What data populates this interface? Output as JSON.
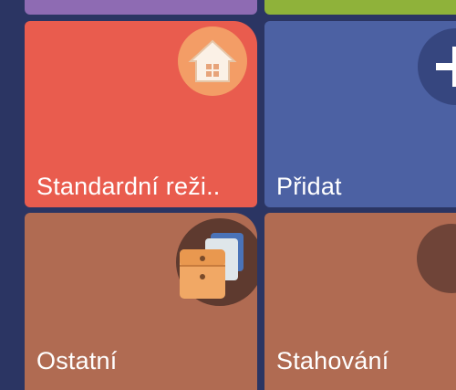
{
  "tiles": [
    {
      "label": "Standardní reži..",
      "icon": "home-icon",
      "color": "#e95c4e"
    },
    {
      "label": "Přidat",
      "icon": "plus-icon",
      "color": "#4c61a3"
    },
    {
      "label": "Ostatní",
      "icon": "archive-box-icon",
      "color": "#b06b52"
    },
    {
      "label": "Stahování",
      "icon": "download-icon",
      "color": "#b06b52"
    }
  ],
  "top_strips": [
    "#8e6bb3",
    "#8fb23a"
  ],
  "background": "#2b3563"
}
